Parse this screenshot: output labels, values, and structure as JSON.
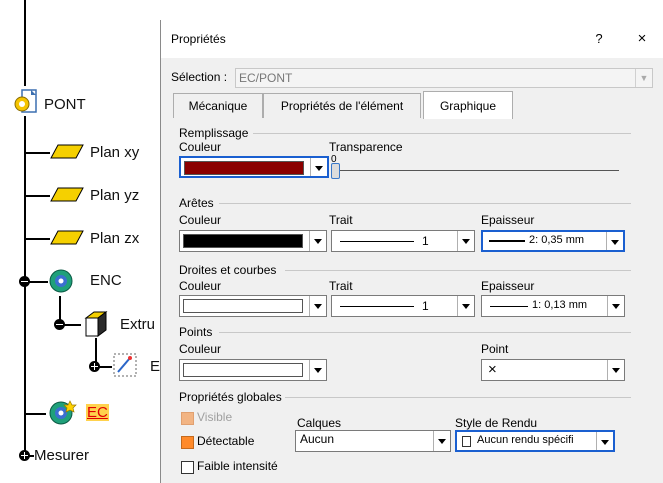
{
  "tree": {
    "items": [
      {
        "label": "PONT"
      },
      {
        "label": "Plan xy"
      },
      {
        "label": "Plan yz"
      },
      {
        "label": "Plan zx"
      },
      {
        "label": "ENC"
      },
      {
        "label": "Extru"
      },
      {
        "label": "E"
      },
      {
        "label": "EC"
      },
      {
        "label": "Mesurer"
      }
    ]
  },
  "dialog": {
    "title": "Propriétés",
    "help": "?",
    "close": "×",
    "selection_label": "Sélection :",
    "selection_value": "EC/PONT",
    "tabs": [
      {
        "label": "Mécanique"
      },
      {
        "label": "Propriétés de l'élément"
      },
      {
        "label": "Graphique"
      }
    ],
    "active_tab": "Graphique"
  },
  "graphique": {
    "remplissage": {
      "title": "Remplissage",
      "color_label": "Couleur",
      "color": "#8b0000",
      "transparence_label": "Transparence",
      "transparence_value": "0"
    },
    "aretes": {
      "title": "Arêtes",
      "color_label": "Couleur",
      "color": "#000000",
      "trait_label": "Trait",
      "trait_value": "1",
      "epaisseur_label": "Epaisseur",
      "epaisseur_value": "2: 0,35 mm"
    },
    "droites": {
      "title": "Droites et courbes",
      "color_label": "Couleur",
      "color": "#ffffff",
      "trait_label": "Trait",
      "trait_value": "1",
      "epaisseur_label": "Epaisseur",
      "epaisseur_value": "1: 0,13 mm"
    },
    "points": {
      "title": "Points",
      "color_label": "Couleur",
      "color": "#ffffff",
      "point_label": "Point",
      "point_value": "×"
    },
    "globales": {
      "title": "Propriétés globales",
      "visible_label": "Visible",
      "detectable_label": "Détectable",
      "faible_label": "Faible intensité",
      "calques_label": "Calques",
      "calques_value": "Aucun",
      "style_label": "Style de Rendu",
      "style_value": "Aucun rendu spécifi"
    }
  }
}
